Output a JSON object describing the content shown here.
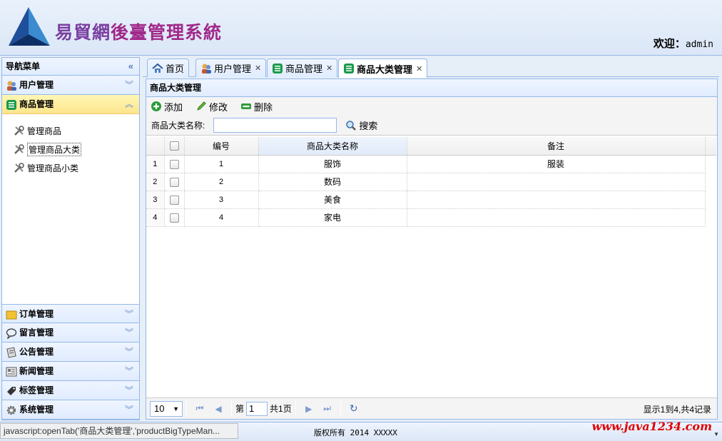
{
  "header": {
    "title_part1": "易貿網",
    "title_part2": "後臺管理系統",
    "welcome_label": "欢迎：",
    "username": "admin"
  },
  "nav": {
    "title": "导航菜单",
    "collapse_icon": "double-chevron-left",
    "sections": [
      {
        "label": "用户管理",
        "icon": "users-icon"
      },
      {
        "label": "商品管理",
        "icon": "list-icon"
      }
    ],
    "product_items": [
      {
        "label": "管理商品"
      },
      {
        "label": "管理商品大类"
      },
      {
        "label": "管理商品小类"
      }
    ],
    "bottom_sections": [
      {
        "label": "订单管理"
      },
      {
        "label": "留言管理"
      },
      {
        "label": "公告管理"
      },
      {
        "label": "新闻管理"
      },
      {
        "label": "标签管理"
      },
      {
        "label": "系统管理"
      }
    ]
  },
  "tabs": [
    {
      "label": "首页"
    },
    {
      "label": "用户管理"
    },
    {
      "label": "商品管理"
    },
    {
      "label": "商品大类管理"
    }
  ],
  "panel": {
    "title": "商品大类管理",
    "toolbar": {
      "add": "添加",
      "edit": "修改",
      "delete": "删除"
    },
    "search_label": "商品大类名称:",
    "search_value": "",
    "search_button": "搜索"
  },
  "grid": {
    "columns": [
      "编号",
      "商品大类名称",
      "备注"
    ],
    "rows": [
      {
        "rn": "1",
        "id": "1",
        "name": "服饰",
        "remark": "服装"
      },
      {
        "rn": "2",
        "id": "2",
        "name": "数码",
        "remark": ""
      },
      {
        "rn": "3",
        "id": "3",
        "name": "美食",
        "remark": ""
      },
      {
        "rn": "4",
        "id": "4",
        "name": "家电",
        "remark": ""
      }
    ]
  },
  "pager": {
    "page_size": "10",
    "page_prefix": "第",
    "page_number": "1",
    "page_total": "共1页",
    "info": "显示1到4,共4记录"
  },
  "footer": {
    "status_text": "javascript:openTab('商品大类管理','productBigTypeMan...",
    "copyright": "版权所有 2014 XXXXX",
    "watermark": "www.java1234.com"
  },
  "colors": {
    "border": "#95b8e7",
    "active_section": "#fde58c",
    "title_purple": "#a0288a"
  }
}
